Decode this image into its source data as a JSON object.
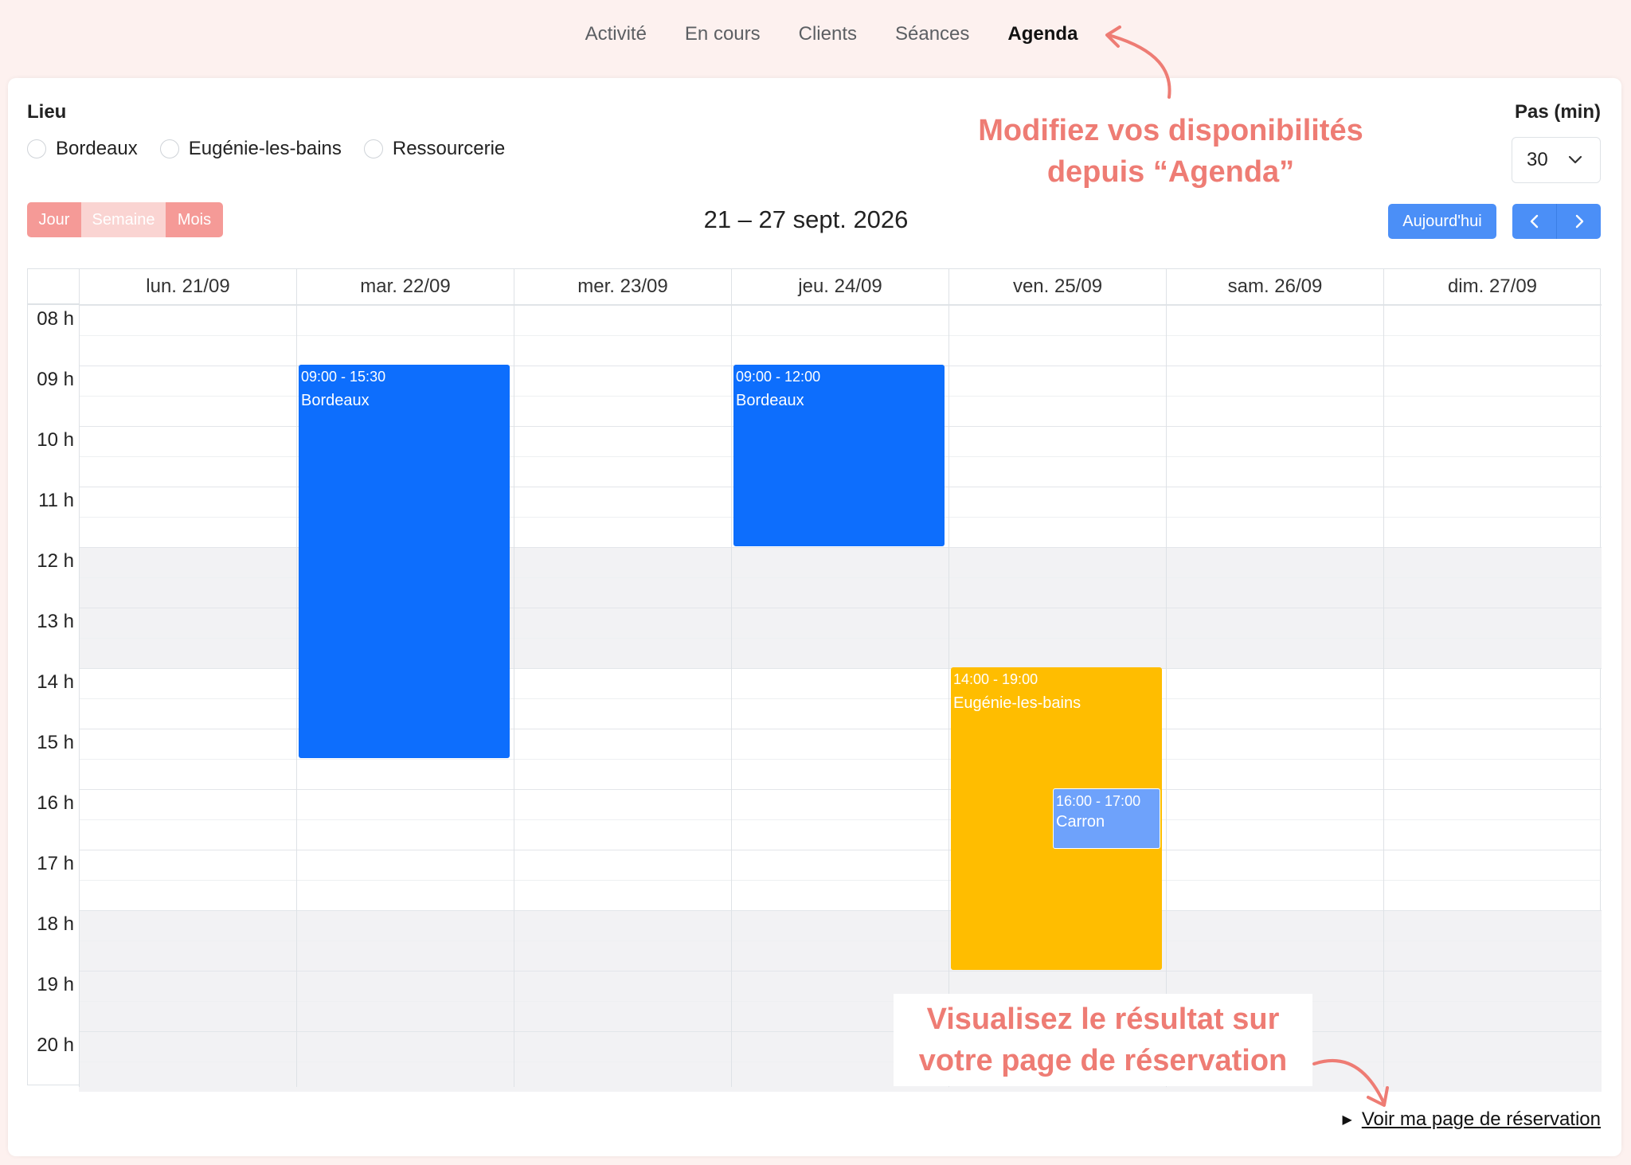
{
  "nav": {
    "items": [
      {
        "label": "Activité"
      },
      {
        "label": "En cours"
      },
      {
        "label": "Clients"
      },
      {
        "label": "Séances"
      },
      {
        "label": "Agenda",
        "active": true
      }
    ]
  },
  "filters": {
    "lieu_title": "Lieu",
    "locations": [
      {
        "label": "Bordeaux",
        "checked": false
      },
      {
        "label": "Eugénie-les-bains",
        "checked": false
      },
      {
        "label": "Ressourcerie",
        "checked": false
      }
    ],
    "pas_title": "Pas (min)",
    "pas_value": "30"
  },
  "toolbar": {
    "views": {
      "jour": "Jour",
      "semaine": "Semaine",
      "mois": "Mois",
      "active": "semaine"
    },
    "range": "21 – 27 sept. 2026",
    "today": "Aujourd'hui",
    "prev_icon": "chevron-left-icon",
    "next_icon": "chevron-right-icon"
  },
  "calendar": {
    "days": [
      "lun. 21/09",
      "mar. 22/09",
      "mer. 23/09",
      "jeu. 24/09",
      "ven. 25/09",
      "sam. 26/09",
      "dim. 27/09"
    ],
    "hours": [
      "08 h",
      "09 h",
      "10 h",
      "11 h",
      "12 h",
      "13 h",
      "14 h",
      "15 h",
      "16 h",
      "17 h",
      "18 h",
      "19 h",
      "20 h"
    ],
    "shaded_hours": [
      "12 h",
      "13 h",
      "18 h",
      "19 h",
      "20 h"
    ],
    "events": [
      {
        "day": 1,
        "start": "09:00",
        "end": "15:30",
        "time": "09:00 - 15:30",
        "title": "Bordeaux",
        "color": "#0d6efd"
      },
      {
        "day": 3,
        "start": "09:00",
        "end": "12:00",
        "time": "09:00 - 12:00",
        "title": "Bordeaux",
        "color": "#0d6efd"
      },
      {
        "day": 4,
        "start": "14:00",
        "end": "19:00",
        "time": "14:00 - 19:00",
        "title": "Eugénie-les-bains",
        "color": "#ffbd00"
      },
      {
        "day": 4,
        "start": "16:00",
        "end": "17:00",
        "time": "16:00 - 17:00",
        "title": "Carron",
        "color": "#6ea2fb"
      }
    ]
  },
  "annotations": {
    "agenda_line1": "Modifiez vos disponibilités",
    "agenda_line2": "depuis “Agenda”",
    "result_line1": "Visualisez le résultat sur",
    "result_line2": "votre page de réservation"
  },
  "footer": {
    "link": "Voir ma page de réservation"
  },
  "colors": {
    "accent_pink": "#f59a97",
    "annotation": "#ee7c74",
    "primary_blue": "#0d6efd",
    "event_yellow": "#ffbd00"
  }
}
